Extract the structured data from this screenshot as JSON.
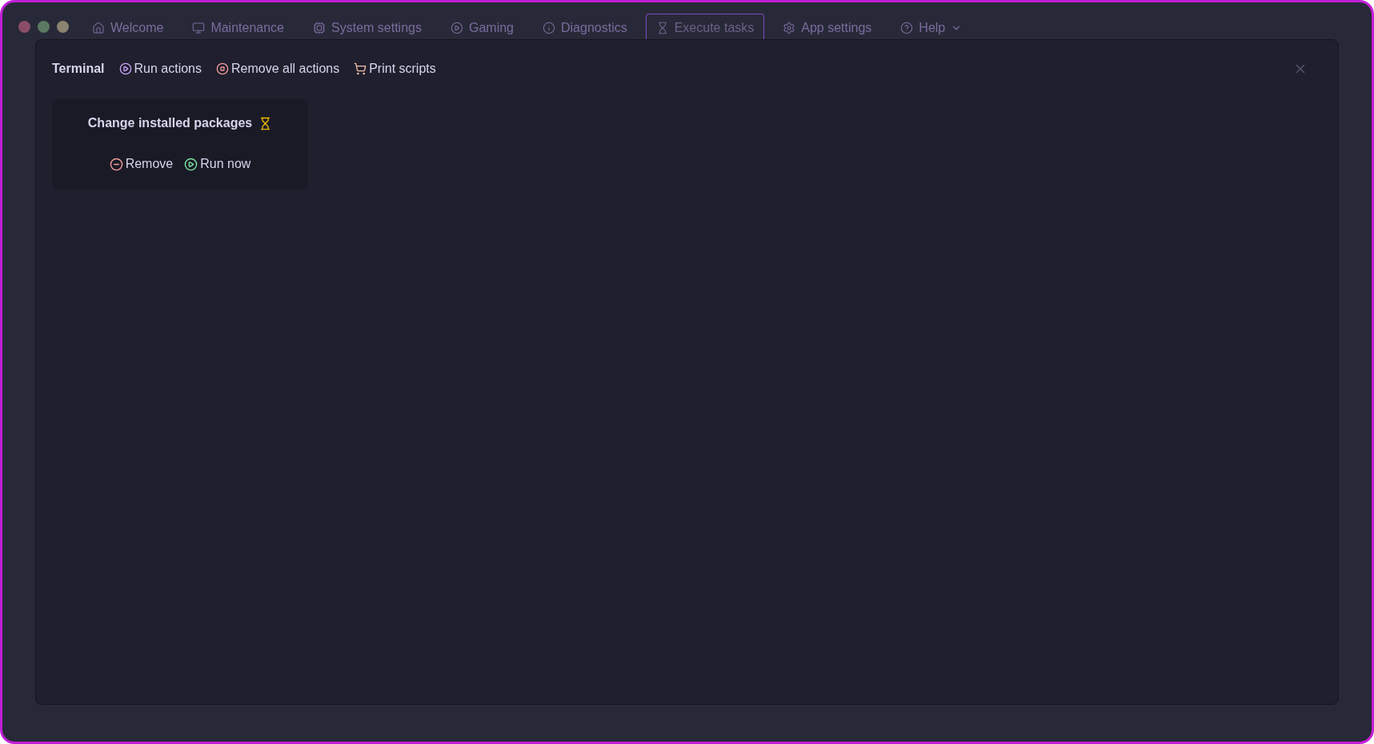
{
  "tabs": [
    {
      "label": "Welcome",
      "kind": "home",
      "selected": false
    },
    {
      "label": "Maintenance",
      "kind": "monitor",
      "selected": false
    },
    {
      "label": "System settings",
      "kind": "chip",
      "selected": false
    },
    {
      "label": "Gaming",
      "kind": "play",
      "selected": false
    },
    {
      "label": "Diagnostics",
      "kind": "info",
      "selected": false
    },
    {
      "label": "Execute tasks",
      "kind": "hourglass",
      "selected": true
    },
    {
      "label": "App settings",
      "kind": "gear",
      "selected": false
    },
    {
      "label": "Help",
      "kind": "help",
      "selected": false,
      "dropdown": true
    }
  ],
  "dialog": {
    "title": "Terminal",
    "toolbar": [
      {
        "label": "Run actions",
        "kind": "run"
      },
      {
        "label": "Remove all actions",
        "kind": "stop"
      },
      {
        "label": "Print scripts",
        "kind": "cart"
      }
    ],
    "tasks": [
      {
        "title": "Change installed packages",
        "pending": true,
        "actions": [
          {
            "label": "Remove",
            "kind": "remove"
          },
          {
            "label": "Run now",
            "kind": "run"
          }
        ]
      }
    ]
  }
}
